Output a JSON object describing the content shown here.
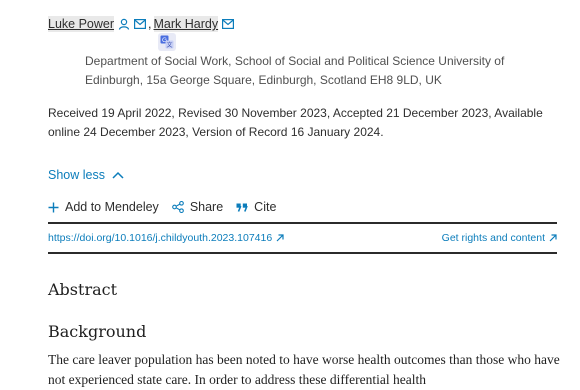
{
  "authors": [
    {
      "name": "Luke Power"
    },
    {
      "name": "Mark Hardy"
    }
  ],
  "author_separator": ",",
  "affiliation": "Department of Social Work, School of Social and Political Science University of Edinburgh, 15a George Square, Edinburgh, Scotland EH8 9LD, UK",
  "dates": "Received 19 April 2022, Revised 30 November 2023, Accepted 21 December 2023, Available online 24 December 2023, Version of Record 16 January 2024.",
  "show_less_label": "Show less",
  "actions": {
    "mendeley": "Add to Mendeley",
    "share": "Share",
    "cite": "Cite"
  },
  "doi": "https://doi.org/10.1016/j.childyouth.2023.107416",
  "rights_label": "Get rights and content",
  "abstract_heading": "Abstract",
  "background_heading": "Background",
  "background_text": "The care leaver population has been noted to have worse health outcomes than those who have not experienced state care. In order to address these differential health",
  "colors": {
    "link": "#0c7dbb",
    "text": "#1f1f1f",
    "rule": "#2b2b2b"
  }
}
